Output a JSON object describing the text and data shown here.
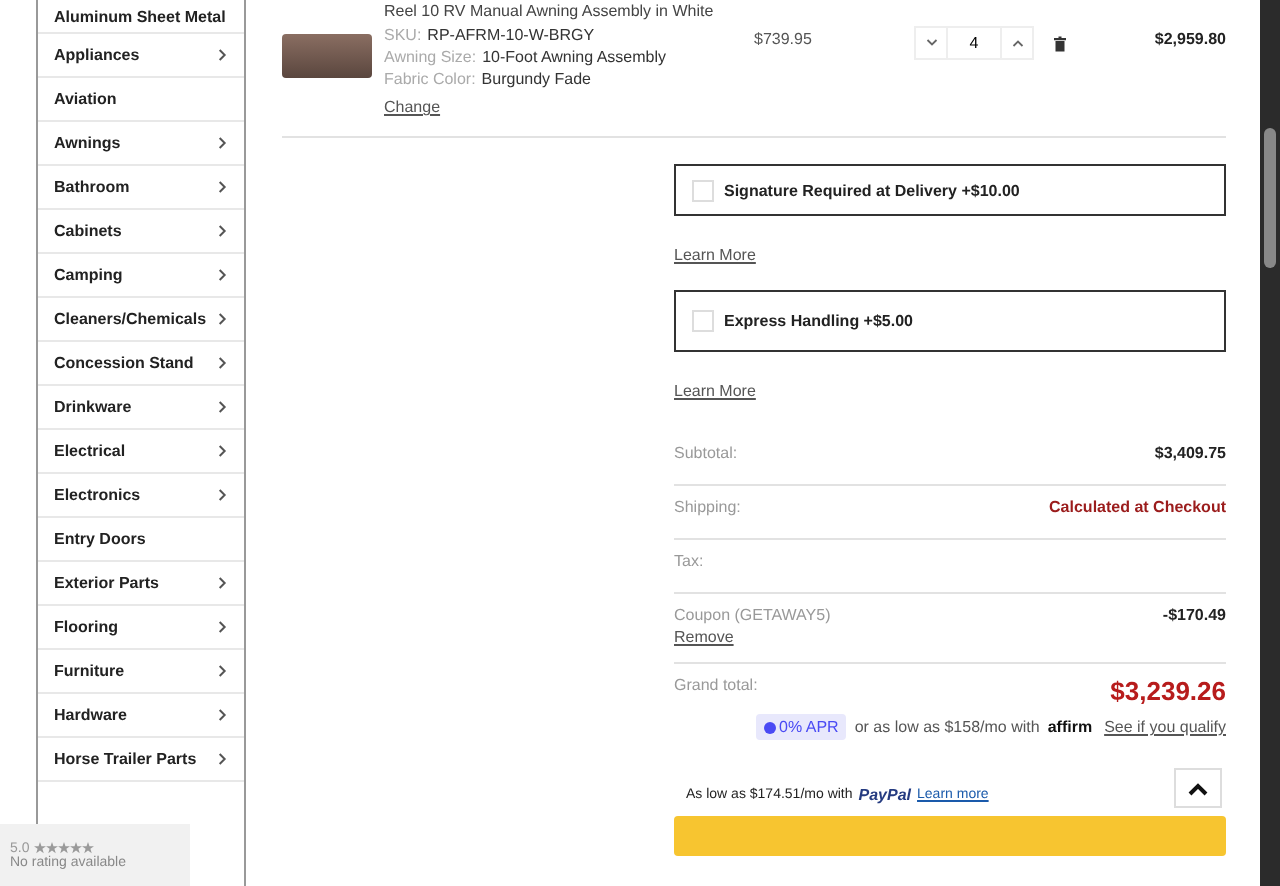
{
  "sidebar": {
    "items": [
      {
        "label": "Aluminum Sheet Metal",
        "has_children": false
      },
      {
        "label": "Appliances",
        "has_children": true
      },
      {
        "label": "Aviation",
        "has_children": false
      },
      {
        "label": "Awnings",
        "has_children": true
      },
      {
        "label": "Bathroom",
        "has_children": true
      },
      {
        "label": "Cabinets",
        "has_children": true
      },
      {
        "label": "Camping",
        "has_children": true
      },
      {
        "label": "Cleaners/Chemicals",
        "has_children": true
      },
      {
        "label": "Concession Stand",
        "has_children": true
      },
      {
        "label": "Drinkware",
        "has_children": true
      },
      {
        "label": "Electrical",
        "has_children": true
      },
      {
        "label": "Electronics",
        "has_children": true
      },
      {
        "label": "Entry Doors",
        "has_children": false
      },
      {
        "label": "Exterior Parts",
        "has_children": true
      },
      {
        "label": "Flooring",
        "has_children": true
      },
      {
        "label": "Furniture",
        "has_children": true
      },
      {
        "label": "Hardware",
        "has_children": true
      },
      {
        "label": "Horse Trailer Parts",
        "has_children": true
      }
    ]
  },
  "cart_item": {
    "title": "Reel 10 RV Manual Awning Assembly in White",
    "attributes": [
      {
        "label": "SKU:",
        "value": "RP-AFRM-10-W-BRGY"
      },
      {
        "label": "Awning Size:",
        "value": "10-Foot Awning Assembly"
      },
      {
        "label": "Fabric Color:",
        "value": "Burgundy Fade"
      }
    ],
    "change_link": "Change",
    "price": "$739.95",
    "quantity": "4",
    "total": "$2,959.80"
  },
  "options": [
    {
      "label": "Signature Required at Delivery +$10.00",
      "checked": false,
      "link": "Learn More"
    },
    {
      "label": "Express Handling +$5.00",
      "checked": false,
      "link": "Learn More"
    }
  ],
  "summary": {
    "rows": [
      {
        "label": "Subtotal:",
        "value": "$3,409.75",
        "kind": "plain"
      },
      {
        "label": "Shipping:",
        "value": "Calculated at Checkout",
        "kind": "notice"
      },
      {
        "label": "Tax:",
        "kind": "plain"
      },
      {
        "label": "Coupon (GETAWAY5)",
        "value": "-$170.49",
        "kind": "coupon",
        "link": "Remove"
      },
      {
        "label": "Grand total:",
        "value": "$3,239.26",
        "kind": "total"
      }
    ],
    "affirm": {
      "badge": "0% APR",
      "text": "or as low as $158/mo with",
      "logo": "affirm",
      "link": "See if you qualify"
    },
    "paypal": {
      "text": "As low as $174.51/mo with",
      "logo": "PayPal",
      "link": "Learn more"
    }
  },
  "rating_widget": {
    "score": "5.0",
    "text": "No rating available"
  }
}
